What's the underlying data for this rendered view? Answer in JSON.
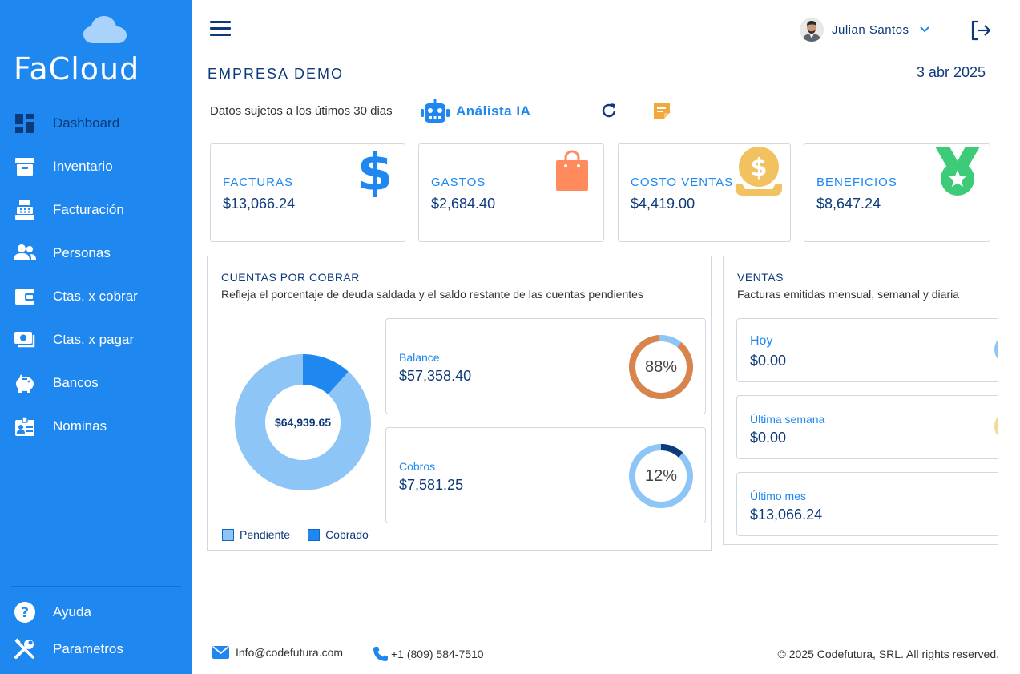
{
  "sidebar": {
    "brand": "FaCloud",
    "items": [
      {
        "label": "Dashboard",
        "icon": "dashboard-icon"
      },
      {
        "label": "Inventario",
        "icon": "archive-icon"
      },
      {
        "label": "Facturación",
        "icon": "cash-register-icon"
      },
      {
        "label": "Personas",
        "icon": "people-icon"
      },
      {
        "label": "Ctas. x cobrar",
        "icon": "wallet-icon"
      },
      {
        "label": "Ctas. x pagar",
        "icon": "money-icon"
      },
      {
        "label": "Bancos",
        "icon": "piggy-bank-icon"
      },
      {
        "label": "Nominas",
        "icon": "badge-icon"
      }
    ],
    "bottom": [
      {
        "label": "Ayuda",
        "icon": "help-icon"
      },
      {
        "label": "Parametros",
        "icon": "tools-icon"
      }
    ]
  },
  "header": {
    "user_name": "Julian Santos",
    "company": "EMPRESA DEMO",
    "date": "3 abr 2025",
    "data_note": "Datos sujetos a los útimos 30 dias",
    "ai_label": "Análista IA"
  },
  "kpis": [
    {
      "title": "FACTURAS",
      "value": "$13,066.24",
      "icon": "dollar-icon",
      "color": "#1e88f0"
    },
    {
      "title": "GASTOS",
      "value": "$2,684.40",
      "icon": "shopping-bag-icon",
      "color": "#ff8a5c"
    },
    {
      "title": "COSTO VENTAS",
      "value": "$4,419.00",
      "icon": "coin-hand-icon",
      "color": "#f2c160"
    },
    {
      "title": "BENEFICIOS",
      "value": "$8,647.24",
      "icon": "medal-icon",
      "color": "#3ecb78"
    }
  ],
  "cuentas": {
    "title": "CUENTAS POR COBRAR",
    "subtitle": "Refleja el porcentaje de deuda saldada y el saldo restante de las cuentas pendientes",
    "total": "$64,939.65",
    "balance_label": "Balance",
    "balance_value": "$57,358.40",
    "balance_pct": "88%",
    "cobros_label": "Cobros",
    "cobros_value": "$7,581.25",
    "cobros_pct": "12%",
    "legend_pendiente": "Pendiente",
    "legend_cobrado": "Cobrado"
  },
  "chart_data": {
    "type": "pie",
    "labels": [
      "Pendiente",
      "Cobrado"
    ],
    "values": [
      57358.4,
      7581.25
    ],
    "colors": [
      "#8ec5f7",
      "#1e88f0"
    ]
  },
  "ventas": {
    "title": "VENTAS",
    "subtitle": "Facturas emitidas mensual, semanal  y diaria",
    "items": [
      {
        "label": "Hoy",
        "value": "$0.00"
      },
      {
        "label": "Última semana",
        "value": "$0.00"
      },
      {
        "label": "Último mes",
        "value": "$13,066.24"
      }
    ]
  },
  "footer": {
    "email": "Info@codefutura.com",
    "phone": "+1 (809) 584-7510",
    "copyright": "© 2025 Codefutura, SRL. All rights reserved."
  }
}
